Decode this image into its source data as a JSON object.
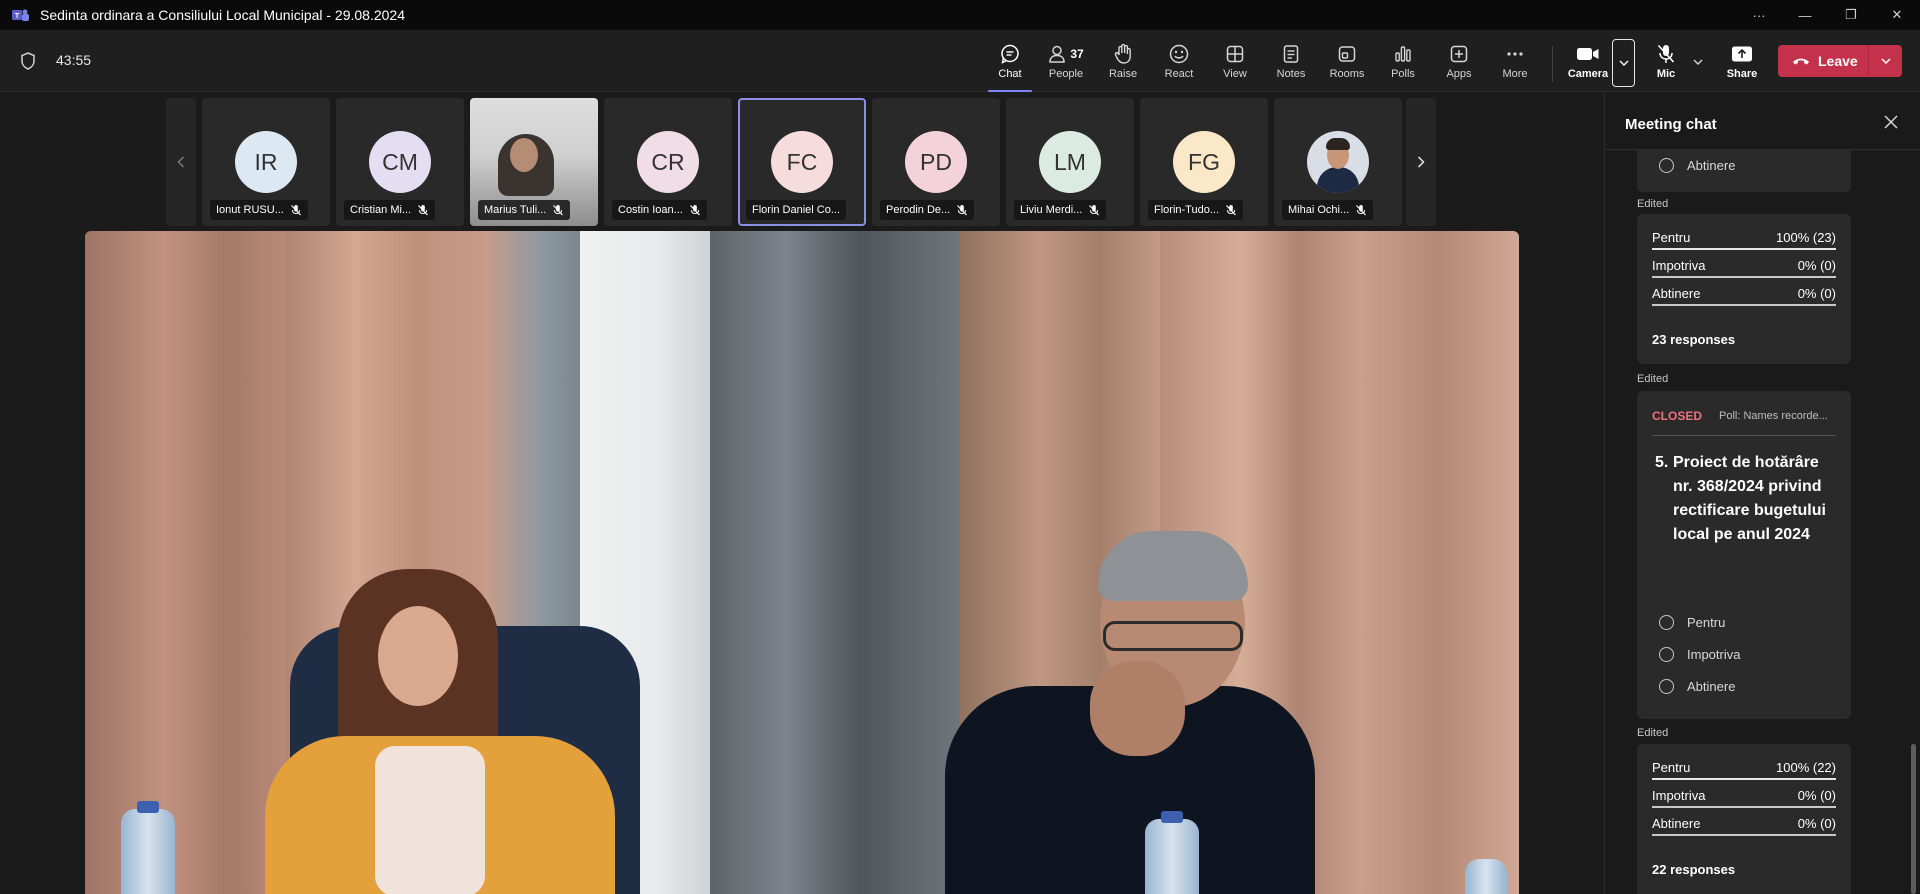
{
  "window": {
    "title": "Sedinta ordinara a Consiliului Local Municipal - 29.08.2024",
    "controls": [
      "···",
      "—",
      "❐",
      "✕"
    ]
  },
  "toolbar": {
    "timer": "43:55",
    "buttons": {
      "chat": "Chat",
      "people": "People",
      "people_count": "37",
      "raise": "Raise",
      "react": "React",
      "view": "View",
      "notes": "Notes",
      "rooms": "Rooms",
      "polls": "Polls",
      "apps": "Apps",
      "more": "More",
      "camera": "Camera",
      "mic": "Mic",
      "share": "Share",
      "leave": "Leave"
    },
    "accent_color": "#7f85f5",
    "leave_color": "#c4314b"
  },
  "participants": [
    {
      "initials": "IR",
      "name": "Ionut RUSU...",
      "color": "#dce9f2",
      "type": "initials"
    },
    {
      "initials": "CM",
      "name": "Cristian Mi...",
      "color": "#e3def2",
      "type": "initials"
    },
    {
      "initials": "",
      "name": "Marius Tuli...",
      "color": "",
      "type": "video"
    },
    {
      "initials": "CR",
      "name": "Costin Ioan...",
      "color": "#f0dde6",
      "type": "initials"
    },
    {
      "initials": "FC",
      "name": "Florin Daniel Co...",
      "color": "#f6dcdc",
      "type": "initials",
      "speaking": true
    },
    {
      "initials": "PD",
      "name": "Perodin De...",
      "color": "#f4d2d9",
      "type": "initials"
    },
    {
      "initials": "LM",
      "name": "Liviu Merdi...",
      "color": "#dcebe2",
      "type": "initials"
    },
    {
      "initials": "FG",
      "name": "Florin-Tudo...",
      "color": "#fbe8c9",
      "type": "initials"
    },
    {
      "initials": "",
      "name": "Mihai Ochi...",
      "color": "",
      "type": "photo"
    }
  ],
  "chat": {
    "title": "Meeting chat",
    "top_option": "Abtinere",
    "edited_label": "Edited",
    "result1": {
      "rows": [
        {
          "label": "Pentru",
          "value": "100% (23)"
        },
        {
          "label": "Impotriva",
          "value": "0% (0)"
        },
        {
          "label": "Abtinere",
          "value": "0% (0)"
        }
      ],
      "responses": "23 responses"
    },
    "poll": {
      "status": "CLOSED",
      "meta": "Poll: Names recorde...",
      "number": "5.",
      "question": "Proiect de hotărâre nr. 368/2024 privind rectificare bugetului local pe anul 2024",
      "options": [
        "Pentru",
        "Impotriva",
        "Abtinere"
      ]
    },
    "result2": {
      "rows": [
        {
          "label": "Pentru",
          "value": "100% (22)"
        },
        {
          "label": "Impotriva",
          "value": "0% (0)"
        },
        {
          "label": "Abtinere",
          "value": "0% (0)"
        }
      ],
      "responses": "22 responses"
    }
  }
}
